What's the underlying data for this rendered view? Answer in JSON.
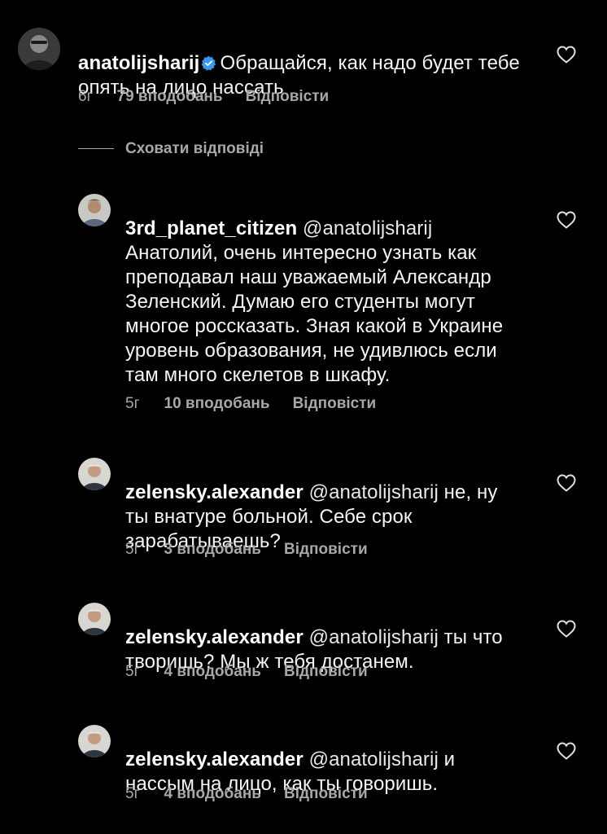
{
  "comments": [
    {
      "username": "anatolijsharij",
      "verified": true,
      "mention": "",
      "text": "Обращайся, как надо будет тебе опять на лицо нассать",
      "time": "6г",
      "likes": "79 вподобань",
      "reply": "Відповісти"
    }
  ],
  "hide_replies": "Сховати відповіді",
  "replies": [
    {
      "username": "3rd_planet_citizen",
      "mention": "@anatolijsharij",
      "text": "Анатолий, очень интересно узнать как преподавал наш уважаемый Александр Зеленский. Думаю его студенты могут многое россказать. Зная какой в Украине уровень образования, не удивлюсь если там много скелетов в шкафу.",
      "time": "5г",
      "likes": "10 вподобань",
      "reply": "Відповісти"
    },
    {
      "username": "zelensky.alexander",
      "mention": "@anatolijsharij",
      "text": "не, ну ты внатуре больной. Себе срок зарабатываешь?",
      "time": "5г",
      "likes": "3 вподобань",
      "reply": "Відповісти"
    },
    {
      "username": "zelensky.alexander",
      "mention": "@anatolijsharij",
      "text": "ты что творишь? Мы ж тебя достанем.",
      "time": "5г",
      "likes": "4 вподобань",
      "reply": "Відповісти"
    },
    {
      "username": "zelensky.alexander",
      "mention": "@anatolijsharij",
      "text": "и нассым на лицо, как ты говоришь.",
      "time": "5г",
      "likes": "4 вподобань",
      "reply": "Відповісти"
    }
  ],
  "icons": {
    "verified": "verified-badge-icon",
    "like": "heart-outline-icon"
  },
  "colors": {
    "background": "#000000",
    "text": "#f5f5f5",
    "secondary": "#a8a8a8",
    "verified": "#3897f0"
  }
}
